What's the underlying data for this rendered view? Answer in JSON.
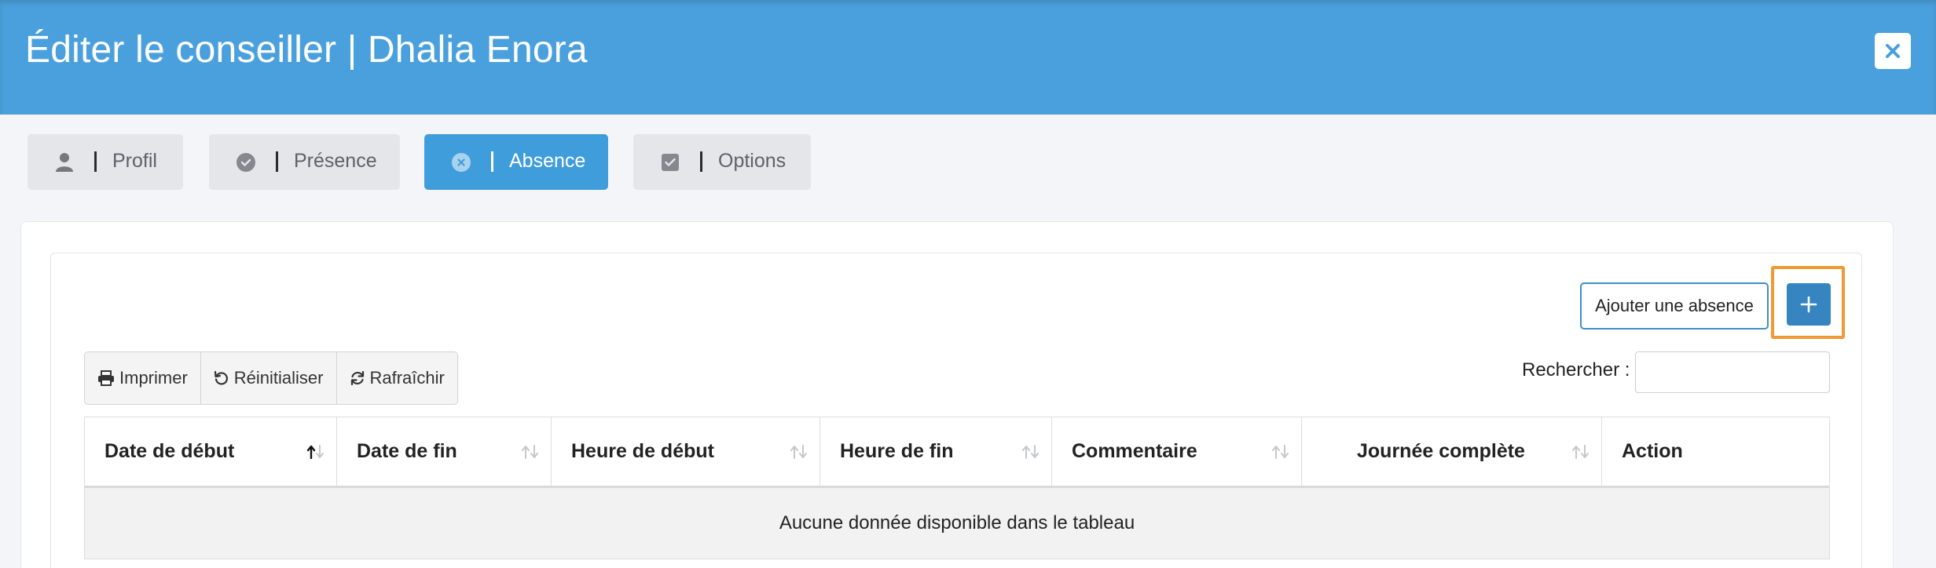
{
  "header": {
    "title": "Éditer le conseiller | Dhalia Enora",
    "close_icon": "close-icon"
  },
  "tabs": [
    {
      "label": "Profil",
      "icon": "user-icon",
      "active": false
    },
    {
      "label": "Présence",
      "icon": "check-circle-icon",
      "active": false
    },
    {
      "label": "Absence",
      "icon": "times-circle-icon",
      "active": true
    },
    {
      "label": "Options",
      "icon": "check-square-icon",
      "active": false
    }
  ],
  "actions": {
    "add_absence_label": "Ajouter une absence",
    "plus_label": "+"
  },
  "toolbar": {
    "print_label": "Imprimer",
    "reset_label": "Réinitialiser",
    "refresh_label": "Rafraîchir"
  },
  "search": {
    "label": "Rechercher :",
    "value": "",
    "placeholder": ""
  },
  "table": {
    "columns": [
      {
        "label": "Date de début",
        "sort": "asc"
      },
      {
        "label": "Date de fin",
        "sort": "both"
      },
      {
        "label": "Heure de début",
        "sort": "both"
      },
      {
        "label": "Heure de fin",
        "sort": "both"
      },
      {
        "label": "Commentaire",
        "sort": "both"
      },
      {
        "label": "Journée complète",
        "sort": "both"
      },
      {
        "label": "Action",
        "sort": "none"
      }
    ],
    "empty_message": "Aucune donnée disponible dans le tableau"
  },
  "colors": {
    "header_bg": "#4aa0dc",
    "active_tab": "#3f9ddc",
    "primary_button": "#3685c0",
    "highlight": "#ef9a33"
  }
}
